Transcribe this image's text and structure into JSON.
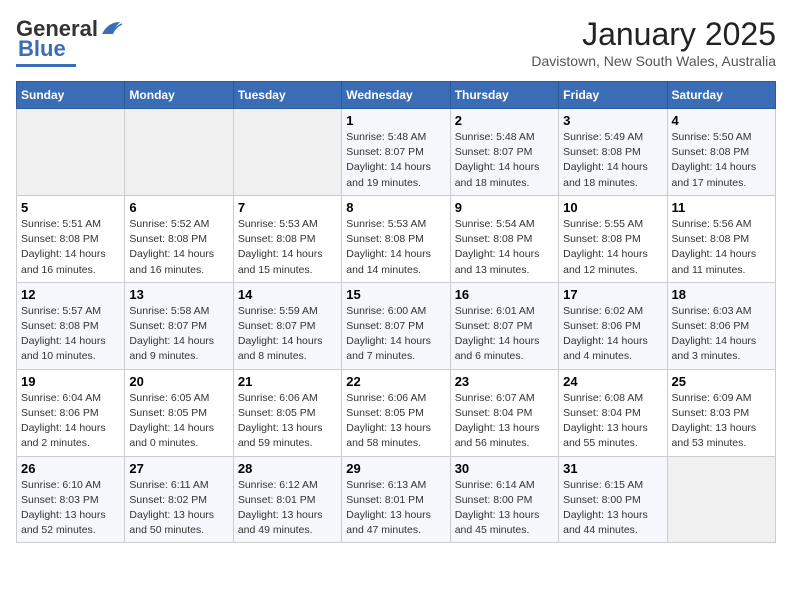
{
  "header": {
    "logo_general": "General",
    "logo_blue": "Blue",
    "month_title": "January 2025",
    "location": "Davistown, New South Wales, Australia"
  },
  "days_of_week": [
    "Sunday",
    "Monday",
    "Tuesday",
    "Wednesday",
    "Thursday",
    "Friday",
    "Saturday"
  ],
  "weeks": [
    [
      {
        "day": "",
        "info": ""
      },
      {
        "day": "",
        "info": ""
      },
      {
        "day": "",
        "info": ""
      },
      {
        "day": "1",
        "info": "Sunrise: 5:48 AM\nSunset: 8:07 PM\nDaylight: 14 hours\nand 19 minutes."
      },
      {
        "day": "2",
        "info": "Sunrise: 5:48 AM\nSunset: 8:07 PM\nDaylight: 14 hours\nand 18 minutes."
      },
      {
        "day": "3",
        "info": "Sunrise: 5:49 AM\nSunset: 8:08 PM\nDaylight: 14 hours\nand 18 minutes."
      },
      {
        "day": "4",
        "info": "Sunrise: 5:50 AM\nSunset: 8:08 PM\nDaylight: 14 hours\nand 17 minutes."
      }
    ],
    [
      {
        "day": "5",
        "info": "Sunrise: 5:51 AM\nSunset: 8:08 PM\nDaylight: 14 hours\nand 16 minutes."
      },
      {
        "day": "6",
        "info": "Sunrise: 5:52 AM\nSunset: 8:08 PM\nDaylight: 14 hours\nand 16 minutes."
      },
      {
        "day": "7",
        "info": "Sunrise: 5:53 AM\nSunset: 8:08 PM\nDaylight: 14 hours\nand 15 minutes."
      },
      {
        "day": "8",
        "info": "Sunrise: 5:53 AM\nSunset: 8:08 PM\nDaylight: 14 hours\nand 14 minutes."
      },
      {
        "day": "9",
        "info": "Sunrise: 5:54 AM\nSunset: 8:08 PM\nDaylight: 14 hours\nand 13 minutes."
      },
      {
        "day": "10",
        "info": "Sunrise: 5:55 AM\nSunset: 8:08 PM\nDaylight: 14 hours\nand 12 minutes."
      },
      {
        "day": "11",
        "info": "Sunrise: 5:56 AM\nSunset: 8:08 PM\nDaylight: 14 hours\nand 11 minutes."
      }
    ],
    [
      {
        "day": "12",
        "info": "Sunrise: 5:57 AM\nSunset: 8:08 PM\nDaylight: 14 hours\nand 10 minutes."
      },
      {
        "day": "13",
        "info": "Sunrise: 5:58 AM\nSunset: 8:07 PM\nDaylight: 14 hours\nand 9 minutes."
      },
      {
        "day": "14",
        "info": "Sunrise: 5:59 AM\nSunset: 8:07 PM\nDaylight: 14 hours\nand 8 minutes."
      },
      {
        "day": "15",
        "info": "Sunrise: 6:00 AM\nSunset: 8:07 PM\nDaylight: 14 hours\nand 7 minutes."
      },
      {
        "day": "16",
        "info": "Sunrise: 6:01 AM\nSunset: 8:07 PM\nDaylight: 14 hours\nand 6 minutes."
      },
      {
        "day": "17",
        "info": "Sunrise: 6:02 AM\nSunset: 8:06 PM\nDaylight: 14 hours\nand 4 minutes."
      },
      {
        "day": "18",
        "info": "Sunrise: 6:03 AM\nSunset: 8:06 PM\nDaylight: 14 hours\nand 3 minutes."
      }
    ],
    [
      {
        "day": "19",
        "info": "Sunrise: 6:04 AM\nSunset: 8:06 PM\nDaylight: 14 hours\nand 2 minutes."
      },
      {
        "day": "20",
        "info": "Sunrise: 6:05 AM\nSunset: 8:05 PM\nDaylight: 14 hours\nand 0 minutes."
      },
      {
        "day": "21",
        "info": "Sunrise: 6:06 AM\nSunset: 8:05 PM\nDaylight: 13 hours\nand 59 minutes."
      },
      {
        "day": "22",
        "info": "Sunrise: 6:06 AM\nSunset: 8:05 PM\nDaylight: 13 hours\nand 58 minutes."
      },
      {
        "day": "23",
        "info": "Sunrise: 6:07 AM\nSunset: 8:04 PM\nDaylight: 13 hours\nand 56 minutes."
      },
      {
        "day": "24",
        "info": "Sunrise: 6:08 AM\nSunset: 8:04 PM\nDaylight: 13 hours\nand 55 minutes."
      },
      {
        "day": "25",
        "info": "Sunrise: 6:09 AM\nSunset: 8:03 PM\nDaylight: 13 hours\nand 53 minutes."
      }
    ],
    [
      {
        "day": "26",
        "info": "Sunrise: 6:10 AM\nSunset: 8:03 PM\nDaylight: 13 hours\nand 52 minutes."
      },
      {
        "day": "27",
        "info": "Sunrise: 6:11 AM\nSunset: 8:02 PM\nDaylight: 13 hours\nand 50 minutes."
      },
      {
        "day": "28",
        "info": "Sunrise: 6:12 AM\nSunset: 8:01 PM\nDaylight: 13 hours\nand 49 minutes."
      },
      {
        "day": "29",
        "info": "Sunrise: 6:13 AM\nSunset: 8:01 PM\nDaylight: 13 hours\nand 47 minutes."
      },
      {
        "day": "30",
        "info": "Sunrise: 6:14 AM\nSunset: 8:00 PM\nDaylight: 13 hours\nand 45 minutes."
      },
      {
        "day": "31",
        "info": "Sunrise: 6:15 AM\nSunset: 8:00 PM\nDaylight: 13 hours\nand 44 minutes."
      },
      {
        "day": "",
        "info": ""
      }
    ]
  ]
}
